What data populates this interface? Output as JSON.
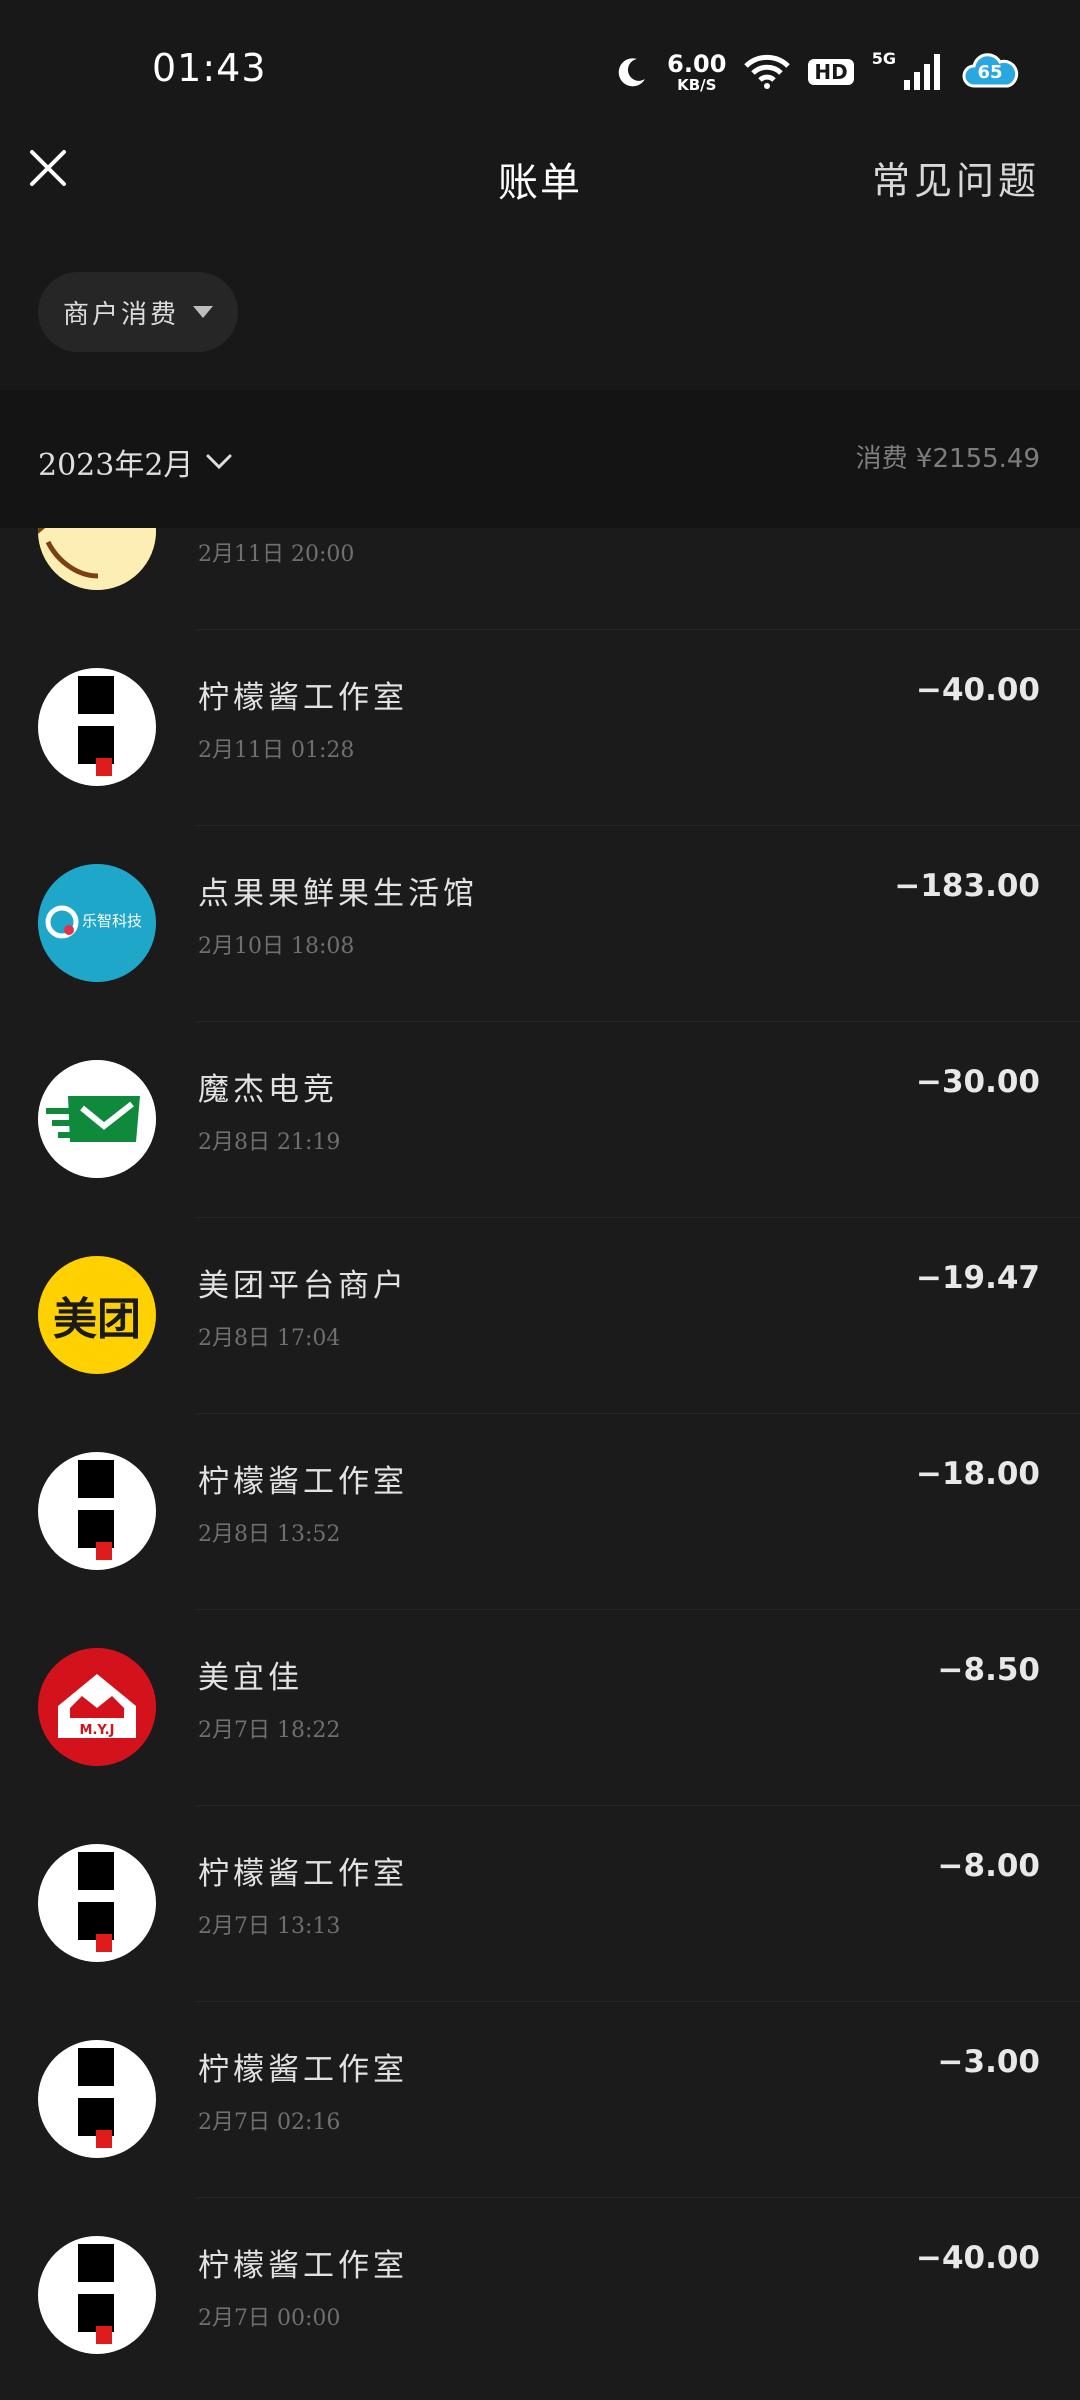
{
  "status_bar": {
    "time": "01:43",
    "speed_value": "6.00",
    "speed_unit": "KB/S",
    "hd": "HD",
    "network": "5G",
    "battery": "65"
  },
  "header": {
    "title": "账单",
    "faq": "常见问题"
  },
  "filter": {
    "label": "商户消费"
  },
  "month_bar": {
    "month": "2023年2月",
    "summary": "消费 ¥2155.49"
  },
  "transactions": [
    {
      "name": "",
      "time": "2月11日 20:00",
      "amount": "",
      "avatar": "cartoon-face"
    },
    {
      "name": "柠檬酱工作室",
      "time": "2月11日 01:28",
      "amount": "−40.00",
      "avatar": "block-logo"
    },
    {
      "name": "点果果鲜果生活馆",
      "time": "2月10日 18:08",
      "amount": "−183.00",
      "avatar": "lezhi-logo",
      "avatar_text": "乐智科技"
    },
    {
      "name": "魔杰电竞",
      "time": "2月8日 21:19",
      "amount": "−30.00",
      "avatar": "envelope-logo"
    },
    {
      "name": "美团平台商户",
      "time": "2月8日 17:04",
      "amount": "−19.47",
      "avatar": "meituan-logo",
      "avatar_text": "美团"
    },
    {
      "name": "柠檬酱工作室",
      "time": "2月8日 13:52",
      "amount": "−18.00",
      "avatar": "block-logo"
    },
    {
      "name": "美宜佳",
      "time": "2月7日 18:22",
      "amount": "−8.50",
      "avatar": "myj-logo",
      "avatar_text": "M.Y.J"
    },
    {
      "name": "柠檬酱工作室",
      "time": "2月7日 13:13",
      "amount": "−8.00",
      "avatar": "block-logo"
    },
    {
      "name": "柠檬酱工作室",
      "time": "2月7日 02:16",
      "amount": "−3.00",
      "avatar": "block-logo"
    },
    {
      "name": "柠檬酱工作室",
      "time": "2月7日 00:00",
      "amount": "−40.00",
      "avatar": "block-logo"
    }
  ],
  "colors": {
    "background": "#1b1b1b",
    "header_bg": "#181818",
    "lezhi_blue": "#1ea7c9",
    "meituan_yellow": "#ffd100",
    "myj_red": "#d3121c",
    "envelope_green": "#0f8a3c"
  }
}
